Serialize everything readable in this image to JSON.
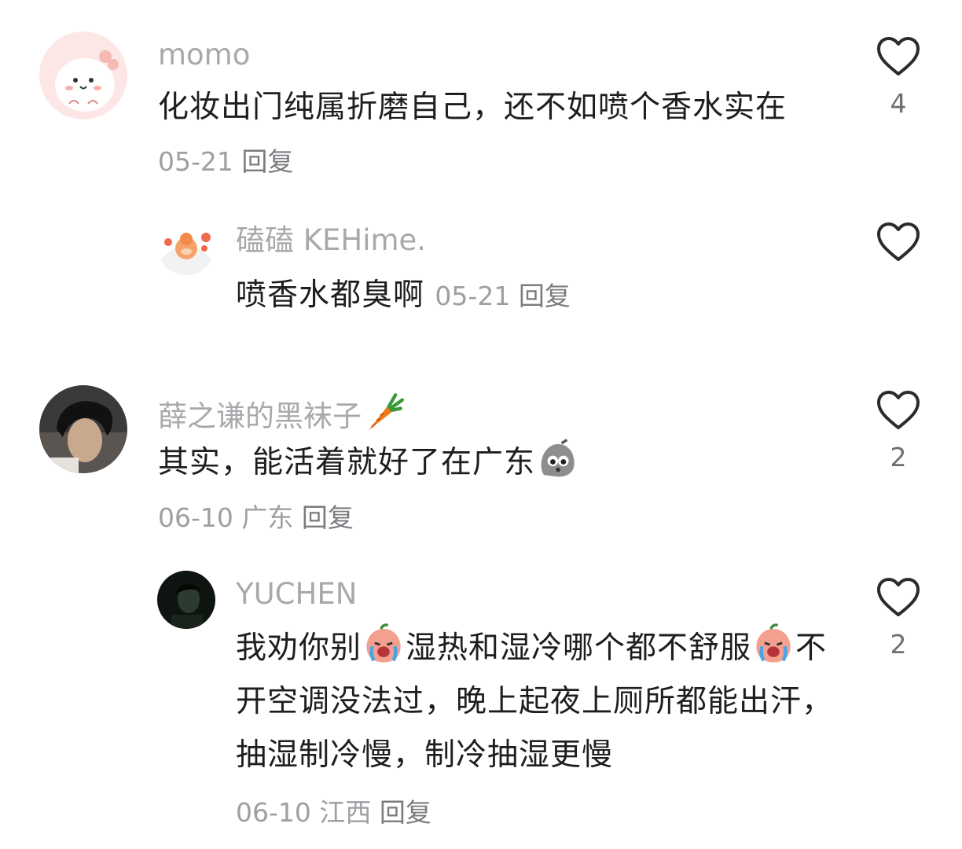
{
  "comments": [
    {
      "author": "momo",
      "text": "化妆出门纯属折磨自己，还不如喷个香水实在",
      "date": "05-21",
      "reply_label": "回复",
      "likes": "4",
      "avatar_icon": "cute-dino-avatar"
    },
    {
      "author": "磕磕 KEHime.",
      "text": "喷香水都臭啊",
      "date": "05-21",
      "reply_label": "回复",
      "likes": "",
      "avatar_icon": "orange-cartoon-avatar"
    },
    {
      "author": "薛之谦的黑袜子",
      "author_emoji": "carrot",
      "text": "其实，能活着就好了在广东",
      "text_emoji": "grey-blob-shocked",
      "date": "06-10",
      "location": "广东",
      "reply_label": "回复",
      "likes": "2",
      "avatar_icon": "person-photo-avatar"
    },
    {
      "author": "YUCHEN",
      "text_part1": "我劝你别",
      "emoji1": "crying-peach",
      "text_part2": "湿热和湿冷哪个都不舒服",
      "emoji2": "crying-peach",
      "text_part3": "不开空调没法过，晚上起夜上厕所都能出汗，抽湿制冷慢，制冷抽湿更慢",
      "date": "06-10",
      "location": "江西",
      "reply_label": "回复",
      "likes": "2",
      "avatar_icon": "dark-photo-avatar"
    }
  ],
  "colors": {
    "author": "#a8a8ad",
    "text": "#1e1e1e",
    "meta": "#9e9ea3",
    "icon": "#2b2b2b"
  }
}
